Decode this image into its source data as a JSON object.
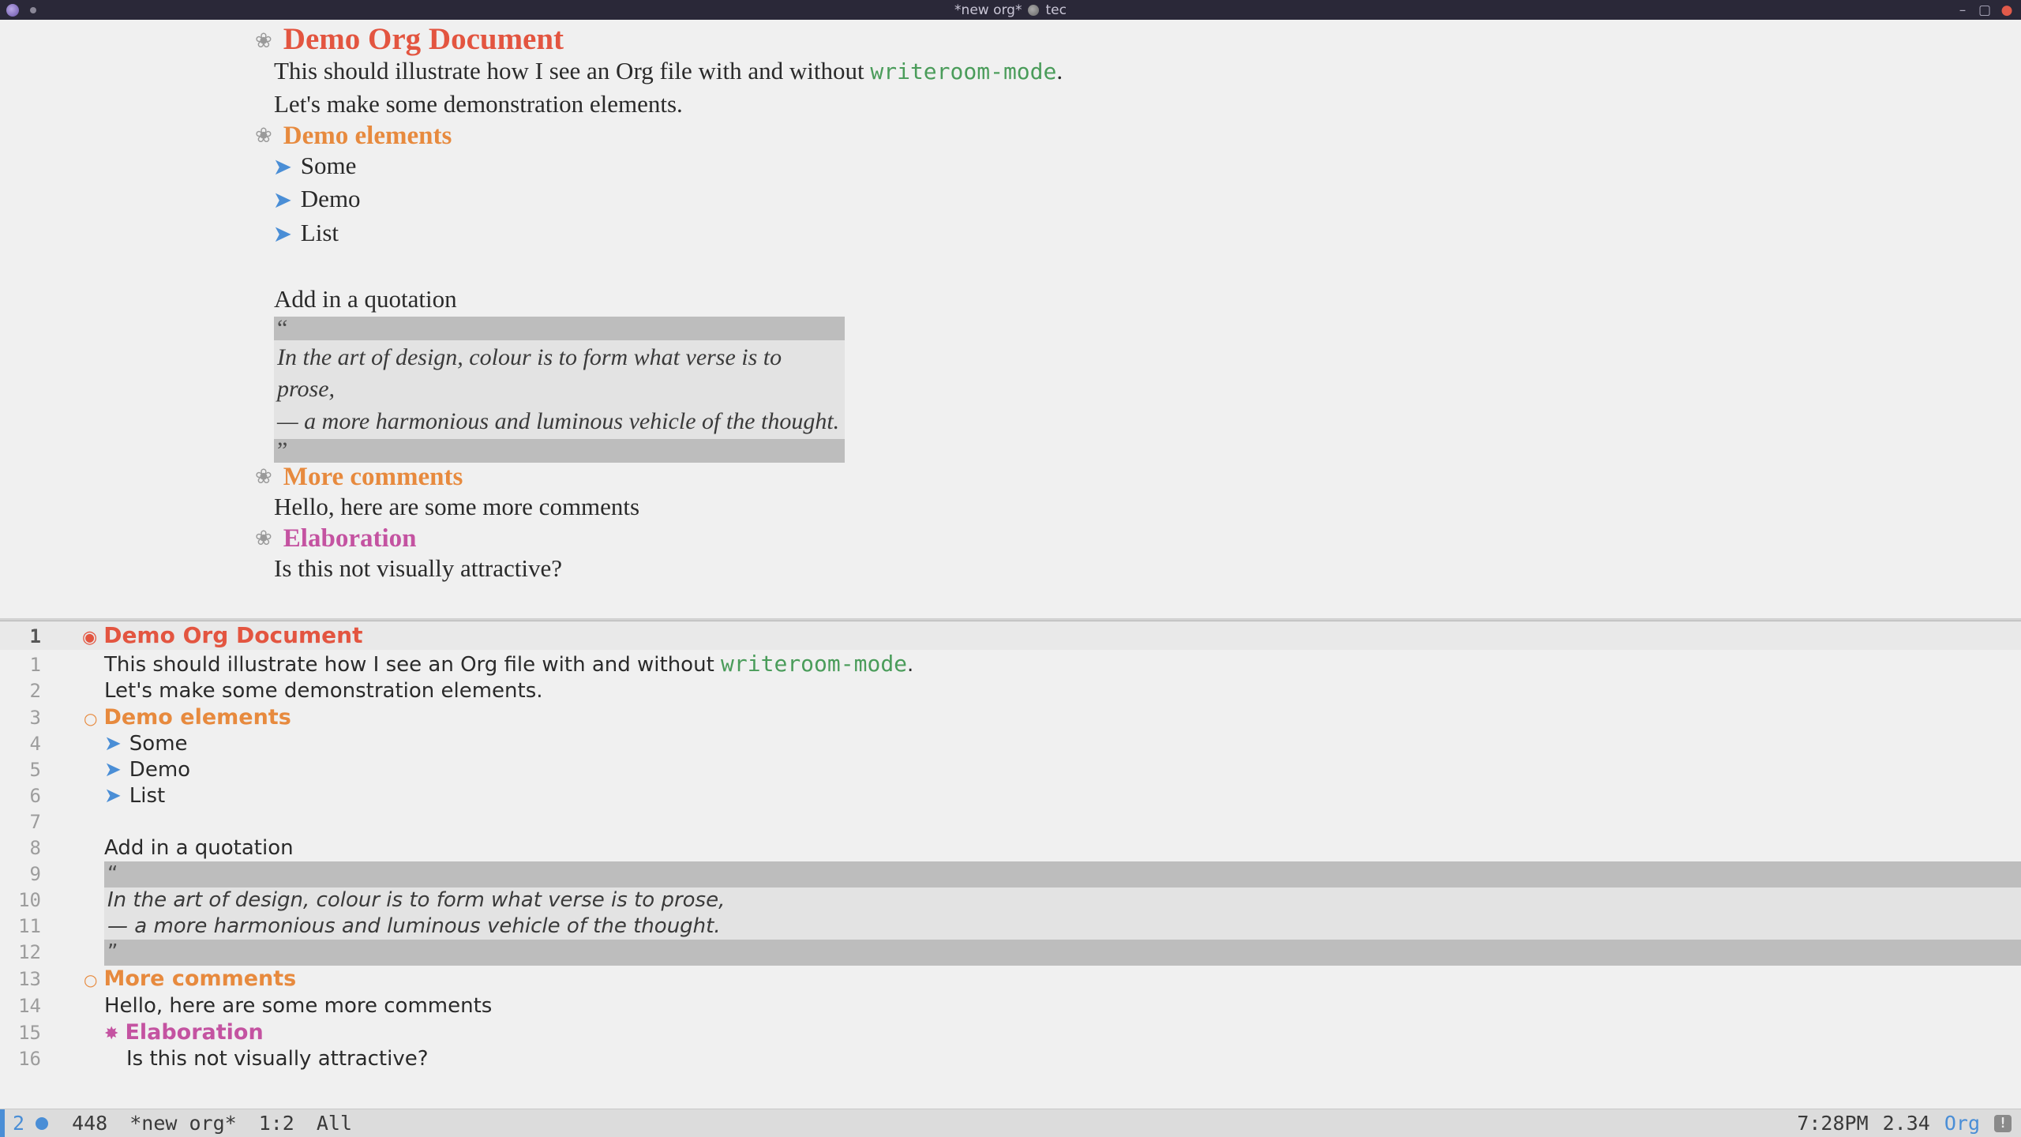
{
  "titlebar": {
    "buffer_name": "*new org*",
    "user": "tec",
    "separator": "●"
  },
  "document": {
    "h1": "Demo Org Document",
    "intro1_a": "This should illustrate how I see an Org file with and without ",
    "intro1_code": "writeroom-mode",
    "intro1_b": ".",
    "intro2": "Let's make some demonstration elements.",
    "h2_elements": "Demo elements",
    "list": [
      "Some",
      "Demo",
      "List"
    ],
    "quote_intro": "Add in a quotation",
    "quote_open": "“",
    "quote_line1": "In the art of design, colour is to form what verse is to prose,",
    "quote_line2": "— a more harmonious and luminous vehicle of the thought.",
    "quote_close": "”",
    "h2_more": "More comments",
    "more_body": "Hello, here are some more comments",
    "h3_elab": "Elaboration",
    "elab_body": "Is this not visually attractive?"
  },
  "normal_pane": {
    "lines": [
      {
        "n": "1",
        "bold": true,
        "kind": "h1"
      },
      {
        "n": "1",
        "kind": "intro1"
      },
      {
        "n": "2",
        "kind": "intro2"
      },
      {
        "n": "3",
        "kind": "h2_elements"
      },
      {
        "n": "4",
        "kind": "li",
        "i": 0
      },
      {
        "n": "5",
        "kind": "li",
        "i": 1
      },
      {
        "n": "6",
        "kind": "li",
        "i": 2
      },
      {
        "n": "7",
        "kind": "blank"
      },
      {
        "n": "8",
        "kind": "quote_intro"
      },
      {
        "n": "9",
        "kind": "quote_open"
      },
      {
        "n": "10",
        "kind": "quote_line1"
      },
      {
        "n": "11",
        "kind": "quote_line2"
      },
      {
        "n": "12",
        "kind": "quote_close"
      },
      {
        "n": "13",
        "kind": "h2_more"
      },
      {
        "n": "14",
        "kind": "more_body"
      },
      {
        "n": "15",
        "kind": "h3_elab"
      },
      {
        "n": "16",
        "kind": "elab_body"
      }
    ]
  },
  "modeline": {
    "workspace": "2",
    "word_count": "448",
    "buffer": "*new org*",
    "position": "1:2",
    "scroll": "All",
    "time": "7:28PM",
    "load": "2.34",
    "major_mode": "Org",
    "warn": "!"
  },
  "glyphs": {
    "h1": "◉",
    "h2": "○",
    "h3": "✸",
    "bullet": "➤",
    "wr_head": "❀"
  }
}
